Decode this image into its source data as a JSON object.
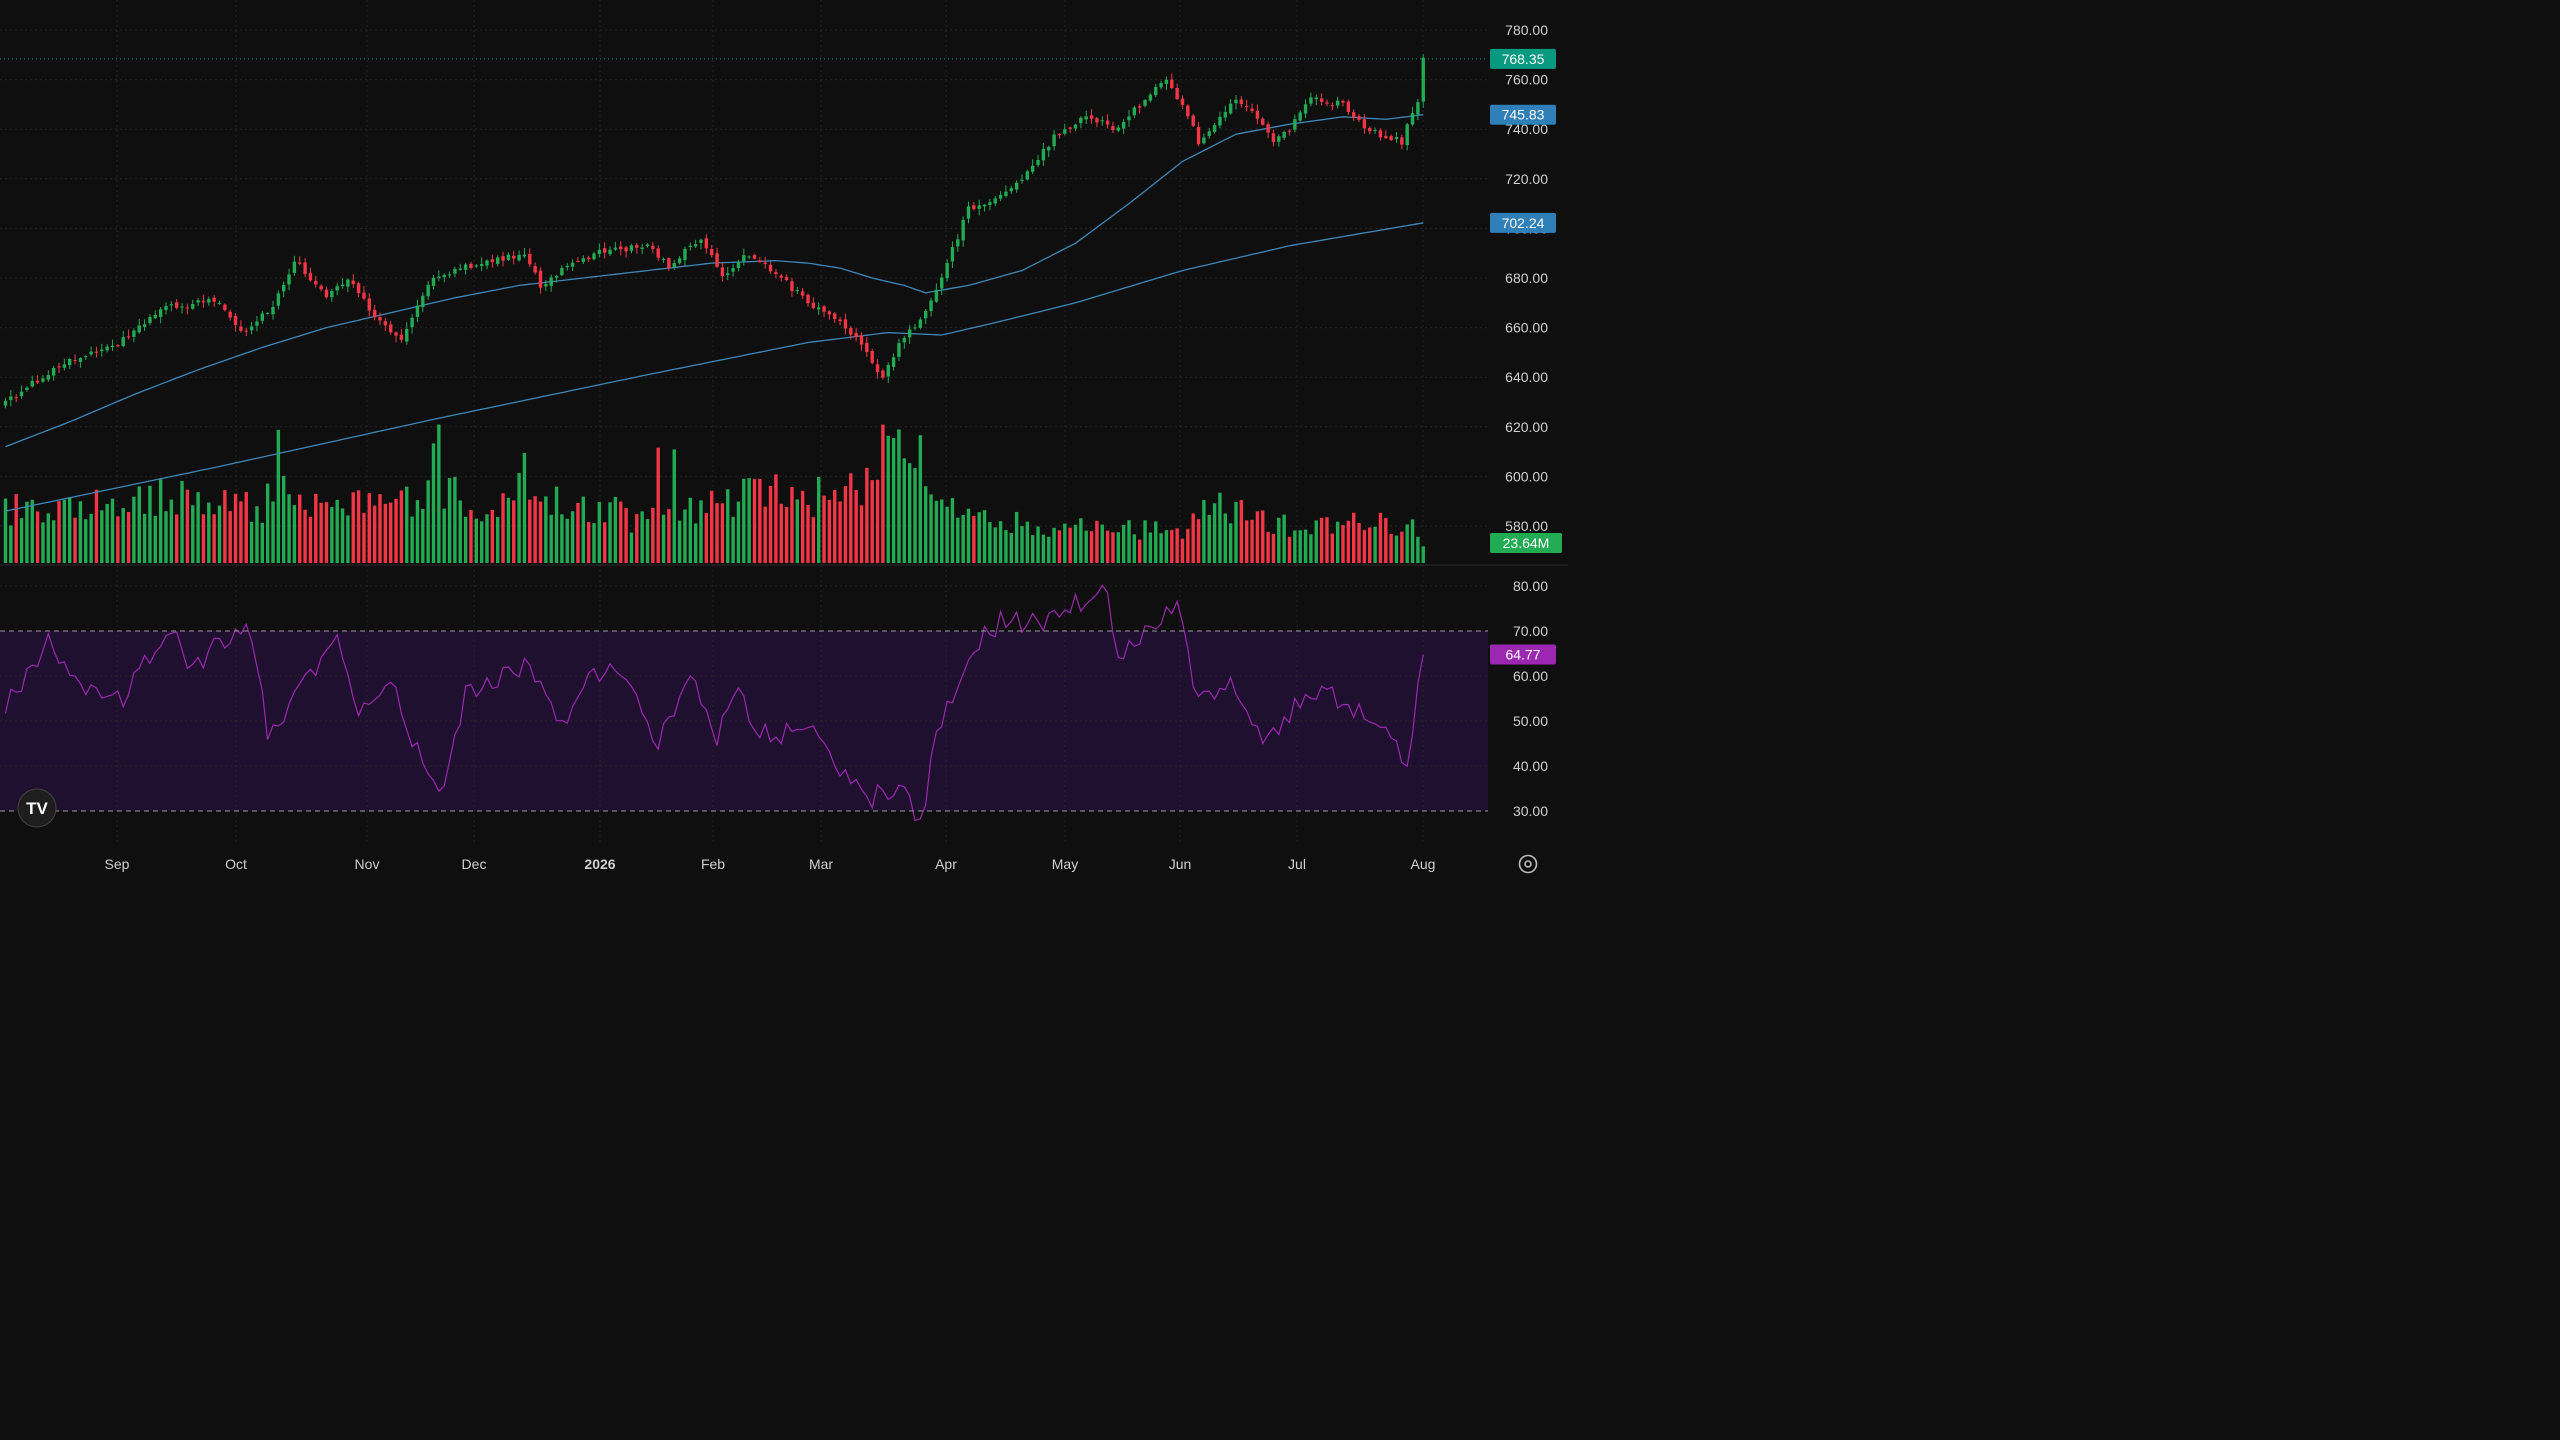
{
  "colors": {
    "background": "#0f0f0f",
    "grid": "#262626",
    "up": "#22ab52",
    "down": "#f23645",
    "ma_short": "#3f87b8",
    "ma_long": "#3f87b8",
    "rsi_line": "#9c27b0",
    "rsi_band": "#1f1030",
    "axis_text": "#cfcfcf",
    "label_price": "#089981",
    "label_ma": "#2f7fb8",
    "label_rsi": "#9c27b0"
  },
  "chart_data": [
    {
      "type": "candlestick",
      "panel": "price",
      "x_ticks": [
        "Sep",
        "Oct",
        "Nov",
        "Dec",
        "2026",
        "Feb",
        "Mar",
        "Apr",
        "May",
        "Jun",
        "Jul",
        "Aug"
      ],
      "y_ticks": [
        "780.00",
        "760.00",
        "740.00",
        "720.00",
        "700.00",
        "680.00",
        "660.00",
        "640.00",
        "620.00",
        "600.00",
        "580.00"
      ],
      "ylim": [
        575,
        785
      ],
      "last_price": "768.35",
      "ma_short_last": "745.83",
      "ma_long_last": "702.24",
      "close_anchors": [
        [
          0,
          630
        ],
        [
          10,
          645
        ],
        [
          20,
          652
        ],
        [
          30,
          668
        ],
        [
          40,
          671
        ],
        [
          44,
          658
        ],
        [
          50,
          668
        ],
        [
          54,
          687
        ],
        [
          60,
          672
        ],
        [
          64,
          680
        ],
        [
          70,
          662
        ],
        [
          74,
          656
        ],
        [
          80,
          680
        ],
        [
          90,
          687
        ],
        [
          97,
          690
        ],
        [
          100,
          677
        ],
        [
          104,
          683
        ],
        [
          110,
          690
        ],
        [
          120,
          693
        ],
        [
          124,
          685
        ],
        [
          130,
          696
        ],
        [
          134,
          680
        ],
        [
          138,
          690
        ],
        [
          142,
          685
        ],
        [
          146,
          678
        ],
        [
          150,
          670
        ],
        [
          156,
          662
        ],
        [
          159,
          655
        ],
        [
          164,
          640
        ],
        [
          167,
          653
        ],
        [
          171,
          663
        ],
        [
          175,
          680
        ],
        [
          180,
          708
        ],
        [
          184,
          710
        ],
        [
          190,
          720
        ],
        [
          196,
          737
        ],
        [
          202,
          745
        ],
        [
          208,
          740
        ],
        [
          214,
          755
        ],
        [
          217,
          760
        ],
        [
          220,
          750
        ],
        [
          223,
          735
        ],
        [
          226,
          742
        ],
        [
          230,
          752
        ],
        [
          233,
          748
        ],
        [
          237,
          735
        ],
        [
          240,
          740
        ],
        [
          244,
          752
        ],
        [
          250,
          750
        ],
        [
          254,
          741
        ],
        [
          258,
          737
        ],
        [
          261,
          735
        ],
        [
          264,
          752
        ],
        [
          265,
          768.35
        ]
      ]
    },
    {
      "type": "line",
      "panel": "price",
      "series": [
        {
          "values": [
            [
              0,
              612
            ],
            [
              12,
              622
            ],
            [
              24,
              633
            ],
            [
              36,
              643
            ],
            [
              48,
              652
            ],
            [
              60,
              660
            ],
            [
              72,
              666
            ],
            [
              84,
              672
            ],
            [
              96,
              677
            ],
            [
              108,
              680
            ],
            [
              120,
              683
            ],
            [
              132,
              686
            ],
            [
              144,
              687
            ],
            [
              150,
              686
            ],
            [
              156,
              684
            ],
            [
              162,
              680
            ],
            [
              168,
              677
            ],
            [
              172,
              674
            ],
            [
              180,
              677
            ],
            [
              190,
              683
            ],
            [
              200,
              694
            ],
            [
              210,
              710
            ],
            [
              220,
              727
            ],
            [
              230,
              738
            ],
            [
              240,
              742
            ],
            [
              250,
              745
            ],
            [
              258,
              744
            ],
            [
              265,
              745.83
            ]
          ]
        },
        {
          "values": [
            [
              0,
              586
            ],
            [
              40,
              604
            ],
            [
              80,
              623
            ],
            [
              120,
              641
            ],
            [
              150,
              654
            ],
            [
              165,
              658
            ],
            [
              175,
              657
            ],
            [
              185,
              662
            ],
            [
              200,
              670
            ],
            [
              220,
              683
            ],
            [
              240,
              693
            ],
            [
              265,
              702.24
            ]
          ]
        }
      ]
    },
    {
      "type": "bar",
      "panel": "volume",
      "last_volume": "23.64M",
      "volume_anchors": [
        [
          0,
          30
        ],
        [
          15,
          32
        ],
        [
          30,
          38
        ],
        [
          48,
          30
        ],
        [
          50,
          45
        ],
        [
          51,
          65
        ],
        [
          53,
          30
        ],
        [
          70,
          33
        ],
        [
          78,
          36
        ],
        [
          80,
          55
        ],
        [
          82,
          40
        ],
        [
          90,
          30
        ],
        [
          96,
          44
        ],
        [
          98,
          40
        ],
        [
          103,
          35
        ],
        [
          110,
          32
        ],
        [
          115,
          28
        ],
        [
          117,
          22
        ],
        [
          120,
          28
        ],
        [
          130,
          30
        ],
        [
          135,
          34
        ],
        [
          140,
          42
        ],
        [
          150,
          36
        ],
        [
          160,
          44
        ],
        [
          165,
          65
        ],
        [
          168,
          58
        ],
        [
          172,
          45
        ],
        [
          175,
          33
        ],
        [
          180,
          24
        ],
        [
          200,
          20
        ],
        [
          220,
          18
        ],
        [
          222,
          34
        ],
        [
          230,
          30
        ],
        [
          240,
          20
        ],
        [
          250,
          22
        ],
        [
          260,
          22
        ],
        [
          263,
          27
        ],
        [
          265,
          8
        ]
      ],
      "volume_spikes": [
        [
          51,
          75
        ],
        [
          81,
          78
        ],
        [
          97,
          62
        ],
        [
          122,
          65
        ],
        [
          125,
          64
        ],
        [
          164,
          78
        ],
        [
          171,
          72
        ]
      ]
    },
    {
      "type": "line",
      "panel": "rsi",
      "y_ticks": [
        "80.00",
        "70.00",
        "60.00",
        "50.00",
        "40.00",
        "30.00"
      ],
      "ylim": [
        26,
        83
      ],
      "bands": [
        30,
        70
      ],
      "last_value": "64.77",
      "rsi_anchors": [
        [
          0,
          53
        ],
        [
          8,
          68
        ],
        [
          14,
          56
        ],
        [
          22,
          55
        ],
        [
          27,
          64
        ],
        [
          32,
          70
        ],
        [
          35,
          61
        ],
        [
          40,
          68
        ],
        [
          46,
          70
        ],
        [
          49,
          47
        ],
        [
          54,
          55
        ],
        [
          62,
          69
        ],
        [
          66,
          53
        ],
        [
          72,
          60
        ],
        [
          78,
          40
        ],
        [
          82,
          35
        ],
        [
          86,
          56
        ],
        [
          93,
          60
        ],
        [
          98,
          63
        ],
        [
          104,
          50
        ],
        [
          110,
          60
        ],
        [
          116,
          61
        ],
        [
          122,
          45
        ],
        [
          128,
          60
        ],
        [
          133,
          47
        ],
        [
          137,
          56
        ],
        [
          143,
          45
        ],
        [
          149,
          50
        ],
        [
          156,
          39
        ],
        [
          162,
          33
        ],
        [
          167,
          35
        ],
        [
          171,
          28
        ],
        [
          175,
          51
        ],
        [
          178,
          58
        ],
        [
          182,
          68
        ],
        [
          186,
          72
        ],
        [
          194,
          72
        ],
        [
          200,
          76
        ],
        [
          206,
          79
        ],
        [
          208,
          63
        ],
        [
          214,
          72
        ],
        [
          219,
          75
        ],
        [
          223,
          53
        ],
        [
          229,
          60
        ],
        [
          235,
          45
        ],
        [
          241,
          53
        ],
        [
          247,
          56
        ],
        [
          253,
          52
        ],
        [
          259,
          45
        ],
        [
          262,
          41
        ],
        [
          265,
          64.77
        ]
      ]
    }
  ]
}
